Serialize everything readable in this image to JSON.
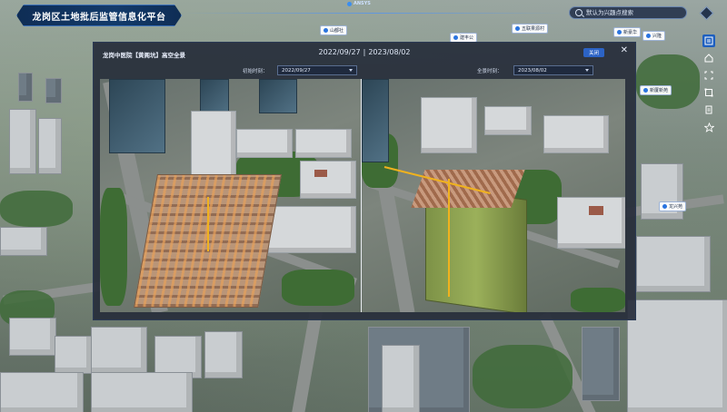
{
  "app": {
    "title": "龙岗区土地批后监管信息化平台",
    "brand": "ANSYS"
  },
  "search": {
    "placeholder": "默认为兴趣点搜索"
  },
  "map_markers": [
    "山都社",
    "建丰公",
    "五联果源村",
    "新豪华",
    "兴隆",
    "新厦新苑",
    "龙兴苑"
  ],
  "modal": {
    "title": "龙岗中医院【黄阁坑】高空全景",
    "date_start": "2022/09/27",
    "date_end": "2023/08/02",
    "separator": "|",
    "close_button": "关闭",
    "left_label": "初始时刻：",
    "left_value": "2022/09/27",
    "right_label": "全景时刻：",
    "right_value": "2023/08/02"
  },
  "toolbar": {
    "items": [
      "layers-icon",
      "home-icon",
      "fullscreen-icon",
      "measure-icon",
      "document-icon",
      "star-icon"
    ]
  },
  "colors": {
    "accent": "#2c63c5",
    "header": "#123a6a",
    "modal_bg": "#262c3a"
  }
}
